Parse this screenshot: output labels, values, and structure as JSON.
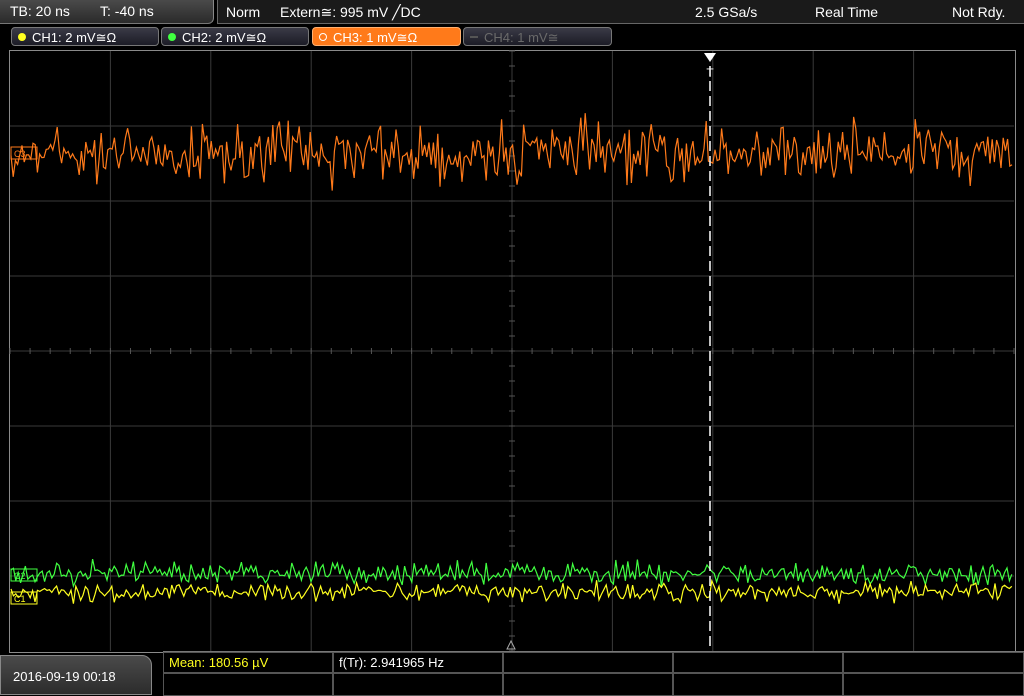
{
  "status": {
    "timebase": "TB: 20 ns",
    "trigger_time": "T: -40 ns",
    "mode": "Norm",
    "trigger_source": "Extern≅: 995 mV ╱DC",
    "sample_rate": "2.5 GSa/s",
    "acq_mode": "Real Time",
    "state": "Not Rdy."
  },
  "channels": [
    {
      "label": "CH1: 2 mV≅Ω",
      "color": "#ffff20",
      "state": "on"
    },
    {
      "label": "CH2: 2 mV≅Ω",
      "color": "#40ff40",
      "state": "on"
    },
    {
      "label": "CH3: 1 mV≅Ω",
      "color": "#ff7a1a",
      "state": "active"
    },
    {
      "label": "CH4: 1 mV≅",
      "color": "#6a6a6a",
      "state": "off"
    }
  ],
  "markers": {
    "ch3": "C3",
    "ch2": "C2",
    "ch1": "C1",
    "trigger": "T"
  },
  "measurements": {
    "mean": "Mean: 180.56 µV",
    "freq": "f(Tr): 2.941965 Hz"
  },
  "datetime": "2016-09-19 00:18",
  "colors": {
    "ch1": "#ffff20",
    "ch2": "#40ff40",
    "ch3": "#ff7a1a",
    "grid": "#3a3a3a"
  }
}
